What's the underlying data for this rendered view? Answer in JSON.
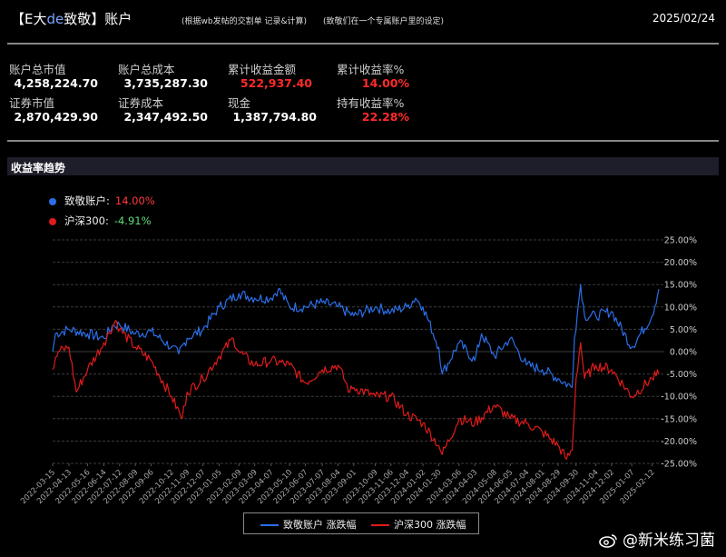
{
  "header": {
    "title_prefix": "【E大",
    "title_de": "de",
    "title_suffix": "致敬】账户",
    "note1": "(根据wb发帖的交割单 记录&计算)",
    "note2": "(致敬们在一个专属账户里的设定)",
    "date": "2025/02/24"
  },
  "stats": {
    "total_market_value_label": "账户总市值",
    "total_market_value": "4,258,224.70",
    "total_cost_label": "账户总成本",
    "total_cost": "3,735,287.30",
    "cum_profit_label": "累计收益金额",
    "cum_profit": "522,937.40",
    "cum_return_label": "累计收益率%",
    "cum_return": "14.00%",
    "securities_value_label": "证券市值",
    "securities_value": "2,870,429.90",
    "securities_cost_label": "证券成本",
    "securities_cost": "2,347,492.50",
    "cash_label": "现金",
    "cash": "1,387,794.80",
    "holding_return_label": "持有收益率%",
    "holding_return": "22.28%"
  },
  "section": {
    "title": "收益率趋势"
  },
  "legend_top": [
    {
      "label": "致敬账户:",
      "value": "14.00%"
    },
    {
      "label": "沪深300:",
      "value": "-4.91%"
    }
  ],
  "legend_bottom": [
    "致敬账户 涨跌幅",
    "沪深300 涨跌幅"
  ],
  "watermark": "@新米练习菌",
  "colors": {
    "account": "#2b6fe8",
    "hs300": "#e01b1b",
    "up": "#ff3a3a",
    "down": "#5fdc78"
  },
  "chart_data": {
    "type": "line",
    "title": "收益率趋势",
    "y_ticks": [
      "25.00%",
      "20.00%",
      "15.00%",
      "10.00%",
      "5.00%",
      "0.00%",
      "-5.00%",
      "-10.00%",
      "-15.00%",
      "-20.00%",
      "-25.00%"
    ],
    "ylim": [
      -25,
      25
    ],
    "x_tick_labels": [
      "2022-03-15",
      "2022-04-13",
      "2022-05-16",
      "2022-06-14",
      "2022-07-12",
      "2022-08-09",
      "2022-09-06",
      "2022-10-12",
      "2022-11-09",
      "2022-12-07",
      "2023-01-05",
      "2023-02-09",
      "2023-03-09",
      "2023-04-07",
      "2023-05-10",
      "2023-06-07",
      "2023-07-07",
      "2023-08-04",
      "2023-09-01",
      "2023-10-09",
      "2023-11-06",
      "2023-12-04",
      "2024-01-02",
      "2024-01-30",
      "2024-03-06",
      "2024-04-03",
      "2024-05-08",
      "2024-06-05",
      "2024-07-04",
      "2024-08-01",
      "2024-08-29",
      "2024-09-30",
      "2024-11-04",
      "2024-12-02",
      "2025-01-07",
      "2025-02-12"
    ],
    "x_start": "2022-03-15",
    "x_end": "2025-02-24",
    "grid": true,
    "series": [
      {
        "name": "致敬账户 涨跌幅",
        "points": [
          [
            "2022-03-15",
            0
          ],
          [
            "2022-03-20",
            4
          ],
          [
            "2022-04-13",
            5
          ],
          [
            "2022-05-16",
            4
          ],
          [
            "2022-06-14",
            3
          ],
          [
            "2022-07-01",
            6
          ],
          [
            "2022-07-12",
            6
          ],
          [
            "2022-08-09",
            4
          ],
          [
            "2022-09-06",
            4.5
          ],
          [
            "2022-10-12",
            1
          ],
          [
            "2022-10-25",
            -0.5
          ],
          [
            "2022-11-09",
            3
          ],
          [
            "2022-12-07",
            5
          ],
          [
            "2023-01-05",
            10
          ],
          [
            "2023-02-09",
            13
          ],
          [
            "2023-03-09",
            12
          ],
          [
            "2023-04-07",
            12
          ],
          [
            "2023-04-20",
            14
          ],
          [
            "2023-05-10",
            10
          ],
          [
            "2023-06-07",
            10
          ],
          [
            "2023-07-07",
            11
          ],
          [
            "2023-08-04",
            10
          ],
          [
            "2023-09-01",
            8
          ],
          [
            "2023-10-09",
            10
          ],
          [
            "2023-11-06",
            9
          ],
          [
            "2023-12-04",
            10
          ],
          [
            "2023-12-20",
            12
          ],
          [
            "2024-01-02",
            10
          ],
          [
            "2024-01-30",
            1
          ],
          [
            "2024-02-05",
            -5
          ],
          [
            "2024-03-06",
            2
          ],
          [
            "2024-04-03",
            -2
          ],
          [
            "2024-04-15",
            4
          ],
          [
            "2024-05-08",
            -1
          ],
          [
            "2024-06-05",
            3
          ],
          [
            "2024-07-04",
            -3
          ],
          [
            "2024-08-01",
            -4
          ],
          [
            "2024-08-29",
            -6
          ],
          [
            "2024-09-23",
            -8
          ],
          [
            "2024-09-27",
            3
          ],
          [
            "2024-10-08",
            15
          ],
          [
            "2024-10-15",
            8
          ],
          [
            "2024-11-04",
            8
          ],
          [
            "2024-12-02",
            9
          ],
          [
            "2025-01-07",
            1
          ],
          [
            "2025-02-12",
            8
          ],
          [
            "2025-02-24",
            14
          ]
        ]
      },
      {
        "name": "沪深300 涨跌幅",
        "points": [
          [
            "2022-03-15",
            -4
          ],
          [
            "2022-03-25",
            0
          ],
          [
            "2022-04-13",
            1
          ],
          [
            "2022-04-26",
            -9
          ],
          [
            "2022-05-16",
            -4
          ],
          [
            "2022-06-14",
            2
          ],
          [
            "2022-07-05",
            7
          ],
          [
            "2022-07-12",
            5
          ],
          [
            "2022-08-09",
            1
          ],
          [
            "2022-09-06",
            -2
          ],
          [
            "2022-10-12",
            -10
          ],
          [
            "2022-10-31",
            -15
          ],
          [
            "2022-11-09",
            -9
          ],
          [
            "2022-12-07",
            -6
          ],
          [
            "2023-01-05",
            -1
          ],
          [
            "2023-01-30",
            3
          ],
          [
            "2023-02-09",
            0
          ],
          [
            "2023-03-09",
            -3
          ],
          [
            "2023-04-07",
            -2
          ],
          [
            "2023-05-10",
            -3
          ],
          [
            "2023-06-07",
            -7
          ],
          [
            "2023-07-07",
            -4
          ],
          [
            "2023-08-04",
            -3
          ],
          [
            "2023-08-25",
            -9
          ],
          [
            "2023-09-01",
            -8
          ],
          [
            "2023-10-09",
            -10
          ],
          [
            "2023-11-06",
            -10
          ],
          [
            "2023-12-04",
            -14
          ],
          [
            "2024-01-02",
            -16
          ],
          [
            "2024-01-30",
            -21
          ],
          [
            "2024-02-05",
            -23
          ],
          [
            "2024-03-06",
            -15
          ],
          [
            "2024-04-03",
            -16
          ],
          [
            "2024-05-08",
            -12
          ],
          [
            "2024-06-05",
            -15
          ],
          [
            "2024-07-04",
            -16
          ],
          [
            "2024-08-01",
            -18
          ],
          [
            "2024-08-29",
            -21
          ],
          [
            "2024-09-13",
            -24
          ],
          [
            "2024-09-23",
            -22
          ],
          [
            "2024-09-30",
            -6
          ],
          [
            "2024-10-08",
            2
          ],
          [
            "2024-10-15",
            -6
          ],
          [
            "2024-11-04",
            -3
          ],
          [
            "2024-12-02",
            -4
          ],
          [
            "2025-01-07",
            -10
          ],
          [
            "2025-02-12",
            -6
          ],
          [
            "2025-02-24",
            -5
          ]
        ]
      }
    ]
  }
}
